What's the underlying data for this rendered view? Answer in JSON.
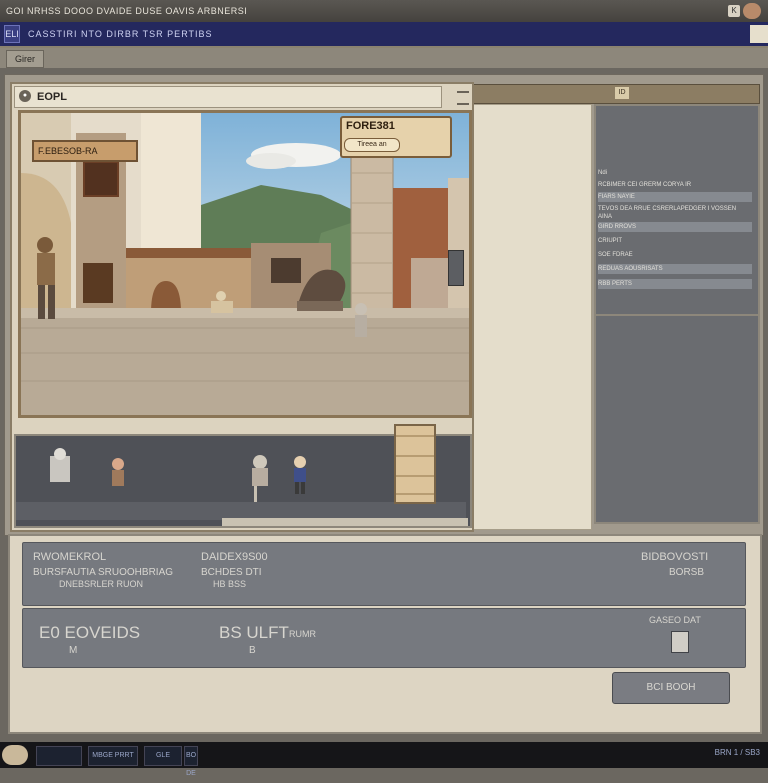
{
  "os_bar": {
    "title": "GOI NRHSS DOOO DVAIDE DUSE OAVIS ARBNERSI",
    "window_icon": "K"
  },
  "app": {
    "icon": "ELI",
    "title": "CASSTIRI NTO  DIRBR TSR  PERTIBS"
  },
  "menu": {
    "button_label": "Girer"
  },
  "game_window": {
    "title": "EOPL",
    "icon": "hamburger-menu-icon"
  },
  "scene": {
    "sign_left": "F.EBESOB-RA",
    "sign_right_title": "FORE381",
    "sign_right_sub": "Tireea an"
  },
  "right_header": {
    "badge": "ID"
  },
  "info_panel": {
    "rows": [
      {
        "text": "Ndi",
        "band": false
      },
      {
        "text": "RCBIMER  CEI  GRERM  CORYA IR",
        "band": false
      },
      {
        "text": "FIARS  NAYIE",
        "band": true
      },
      {
        "text": "TEVOS  DEA  RRUE  CSRERLAPEDGER  I VOSSEN",
        "band": false
      },
      {
        "text": "AINA",
        "band": false
      },
      {
        "text": "GIRD  RROVS",
        "band": true
      },
      {
        "text": "CRIUPIT",
        "band": false
      },
      {
        "text": "SOE  FDRAE",
        "band": false
      },
      {
        "text": "REDUAS  AOUSRISATS",
        "band": true
      },
      {
        "text": "RBB  PERTS",
        "band": true
      }
    ]
  },
  "cards": {
    "card1": {
      "a_title": "RWOMEKROL",
      "a_sub": "BURSFAUTIA SRUOOHBRIAG",
      "a_sub2": "DNEBSRLER RUON",
      "b_title": "DAIDEX9S00",
      "b_sub": "BCHDES DTI",
      "b_sub2": "HB  BSS",
      "c_title": "BIDBOVOSTI",
      "c_sub": "BORSB"
    },
    "card2": {
      "a_value": "E0 EOVEIDS",
      "a_icon": "M",
      "b_value": "BS ULFT",
      "b_sub": "RUMR",
      "b_icon": "B",
      "c_title": "GASEO DAT"
    }
  },
  "action_button": {
    "label": "BCI  BOOH"
  },
  "taskbar": {
    "items": [
      "",
      "MBGE PRRT",
      "GLE",
      "BO DE"
    ],
    "clock": "BRN   1 / SB3"
  }
}
